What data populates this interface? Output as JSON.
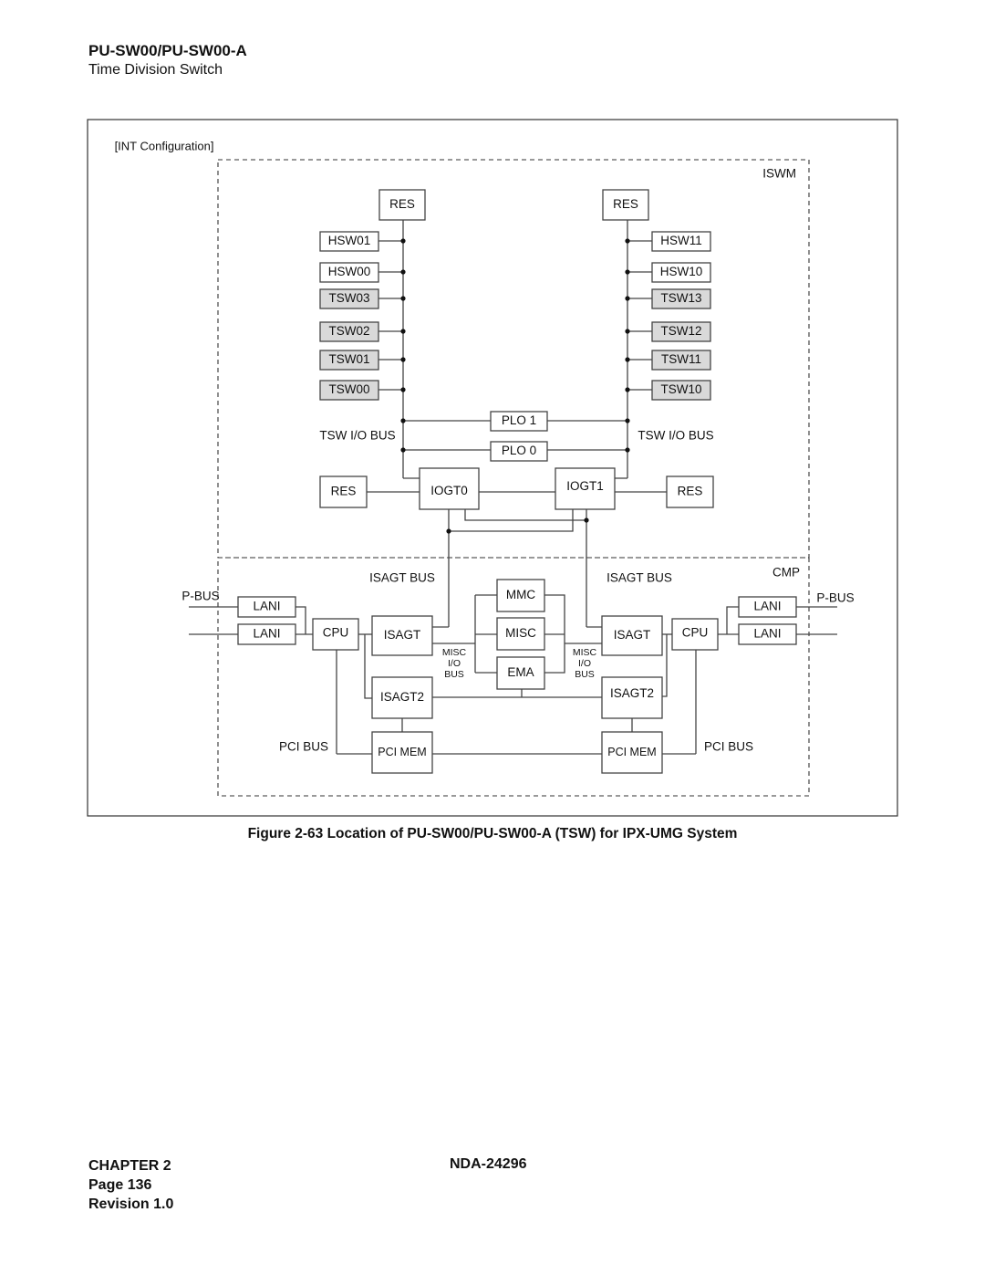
{
  "header": {
    "title": "PU-SW00/PU-SW00-A",
    "subtitle": "Time Division Switch"
  },
  "diagram": {
    "config_label": "[INT Configuration]",
    "regions": {
      "iswm": "ISWM",
      "cmp": "CMP"
    },
    "iswm": {
      "left_column": {
        "top": "RES",
        "slots": [
          {
            "label": "HSW01",
            "shaded": false
          },
          {
            "label": "HSW00",
            "shaded": false
          },
          {
            "label": "TSW03",
            "shaded": true
          },
          {
            "label": "TSW02",
            "shaded": true
          },
          {
            "label": "TSW01",
            "shaded": true
          },
          {
            "label": "TSW00",
            "shaded": true
          }
        ]
      },
      "right_column": {
        "top": "RES",
        "slots": [
          {
            "label": "HSW11",
            "shaded": false
          },
          {
            "label": "HSW10",
            "shaded": false
          },
          {
            "label": "TSW13",
            "shaded": true
          },
          {
            "label": "TSW12",
            "shaded": true
          },
          {
            "label": "TSW11",
            "shaded": true
          },
          {
            "label": "TSW10",
            "shaded": true
          }
        ]
      },
      "plo": [
        "PLO 1",
        "PLO 0"
      ],
      "tsw_io_bus_left": "TSW I/O BUS",
      "tsw_io_bus_right": "TSW I/O BUS",
      "res_left": "RES",
      "res_right": "RES",
      "iogt0": "IOGT0",
      "iogt1": "IOGT1"
    },
    "cmp": {
      "p_bus_left": "P-BUS",
      "p_bus_right": "P-BUS",
      "lani": "LANI",
      "cpu": "CPU",
      "isagt": "ISAGT",
      "isagt2": "ISAGT2",
      "isagt_bus_left": "ISAGT BUS",
      "isagt_bus_right": "ISAGT BUS",
      "mmc": "MMC",
      "misc": "MISC",
      "ema": "EMA",
      "misc_io_bus": [
        "MISC",
        "I/O",
        "BUS"
      ],
      "pci_bus_left": "PCI BUS",
      "pci_bus_right": "PCI BUS",
      "pci_mem": "PCI MEM"
    },
    "colors": {
      "line": "#444444",
      "box_fill": "#ffffff",
      "shaded_fill": "#d9d9d9"
    }
  },
  "caption": "Figure 2-63   Location of PU-SW00/PU-SW00-A (TSW) for IPX-UMG System",
  "footer": {
    "chapter": "CHAPTER 2",
    "page": "Page 136",
    "revision": "Revision 1.0",
    "doc_number": "NDA-24296"
  }
}
